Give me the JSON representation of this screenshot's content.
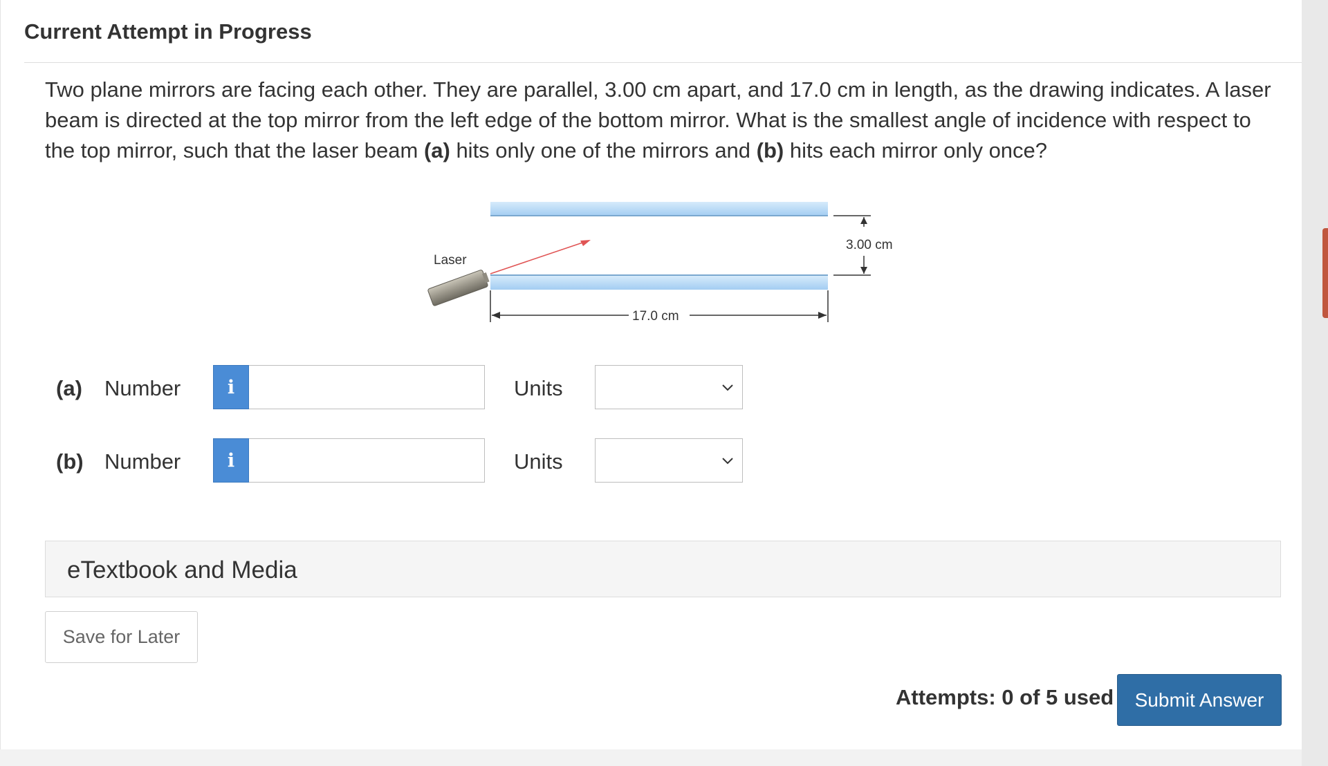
{
  "header": {
    "title": "Current Attempt in Progress"
  },
  "question": {
    "segments": [
      {
        "text": "Two plane mirrors are facing each other. They are parallel, 3.00 cm apart, and 17.0 cm in length, as the drawing indicates. A laser beam is directed at the top mirror from the left edge of the bottom mirror. What is the smallest angle of incidence with respect to the top mirror, such that the laser beam ",
        "bold": false
      },
      {
        "text": "(a)",
        "bold": true
      },
      {
        "text": " hits only one of the mirrors and ",
        "bold": false
      },
      {
        "text": "(b)",
        "bold": true
      },
      {
        "text": " hits each mirror only once?",
        "bold": false
      }
    ]
  },
  "figure": {
    "laser_label": "Laser",
    "gap_label": "3.00 cm",
    "length_label": "17.0 cm"
  },
  "answers": [
    {
      "part": "(a)",
      "number_label": "Number",
      "info_icon": "i",
      "value": "",
      "units_label": "Units",
      "units_selected": ""
    },
    {
      "part": "(b)",
      "number_label": "Number",
      "info_icon": "i",
      "value": "",
      "units_label": "Units",
      "units_selected": ""
    }
  ],
  "etextbook": {
    "label": "eTextbook and Media"
  },
  "footer": {
    "save_label": "Save for Later",
    "attempts_text": "Attempts: 0 of 5 used",
    "submit_label": "Submit Answer"
  },
  "colors": {
    "primary_button": "#2f6ea6",
    "info_button": "#4a8cd6",
    "mirror": "#a9d3f5",
    "laser_beam": "#e05454"
  }
}
